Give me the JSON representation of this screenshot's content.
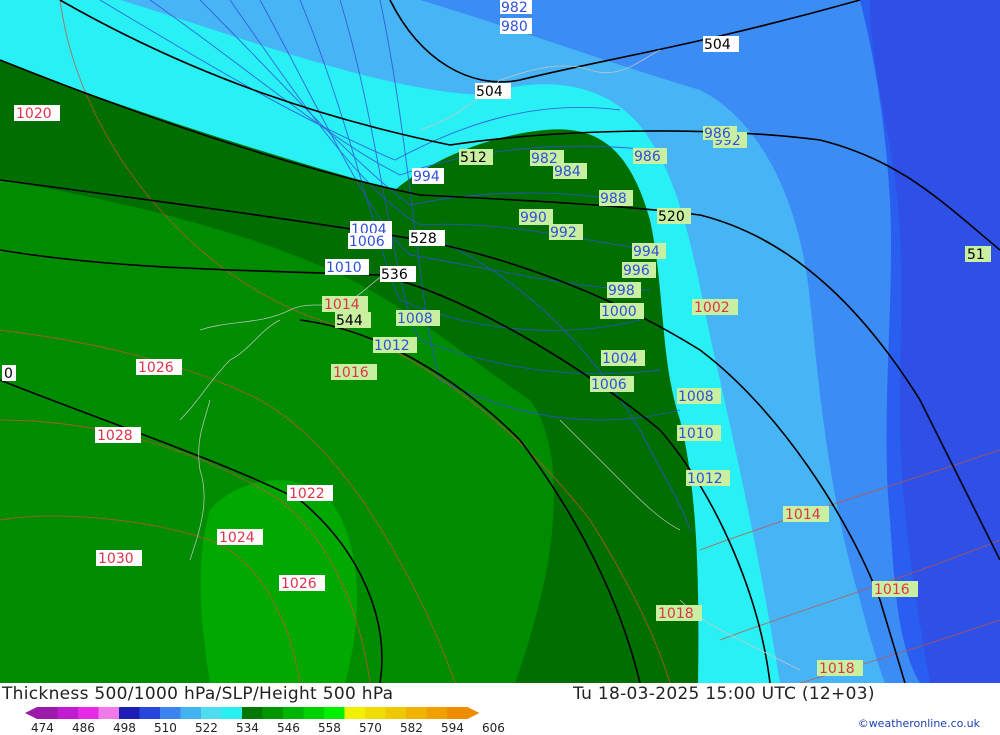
{
  "header": {
    "title": "Thickness 500/1000 hPa/SLP/Height 500 hPa",
    "datetime": "Tu 18-03-2025 15:00 UTC (12+03)",
    "credit": "©weatheronline.co.uk"
  },
  "legend": {
    "ticks": [
      "474",
      "486",
      "498",
      "510",
      "522",
      "534",
      "546",
      "558",
      "570",
      "582",
      "594",
      "606"
    ],
    "colors": [
      "#9b1aa8",
      "#c01bd0",
      "#e629e6",
      "#f07be8",
      "#1e1eb4",
      "#2846dc",
      "#3c82f0",
      "#41b4f0",
      "#50dcf0",
      "#28f0f0",
      "#007800",
      "#009600",
      "#00b400",
      "#00d200",
      "#00f000",
      "#f0f000",
      "#f0dc00",
      "#f0c800",
      "#f0b400",
      "#f0a000",
      "#f08c00"
    ]
  },
  "pressure_labels": {
    "red": [
      "1020",
      "1026",
      "1028",
      "1030",
      "1024",
      "1026",
      "1022",
      "1016",
      "1014",
      "1018",
      "1014",
      "1016",
      "1018",
      "1002"
    ],
    "blue": [
      "982",
      "980",
      "994",
      "1004",
      "1006",
      "1010",
      "1008",
      "1012",
      "990",
      "992",
      "982",
      "984",
      "988",
      "986",
      "992",
      "994",
      "996",
      "998",
      "1000",
      "1004",
      "1006",
      "1008",
      "1010",
      "1012",
      "986"
    ]
  },
  "height_labels": [
    "504",
    "504",
    "512",
    "520",
    "528",
    "536",
    "544",
    "51",
    "0"
  ],
  "colors": {
    "deep_blue": "#2a5ef0",
    "mid_blue": "#3c8cf5",
    "light_blue": "#46b4f5",
    "cyan": "#28f0f5",
    "dark_green": "#006e00",
    "green": "#008c00",
    "bright_green": "#00b400"
  }
}
